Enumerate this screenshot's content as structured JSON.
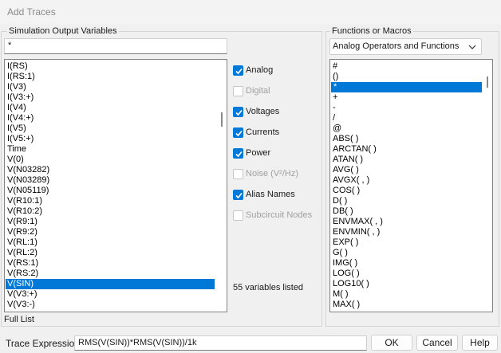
{
  "window": {
    "title": "Add Traces"
  },
  "left_panel": {
    "label": "Simulation Output Variables",
    "filter_value": "*",
    "variables": [
      "I(RS)",
      "I(RS:1)",
      "I(V3)",
      "I(V3:+)",
      "I(V4)",
      "I(V4:+)",
      "I(V5)",
      "I(V5:+)",
      "Time",
      "V(0)",
      "V(N03282)",
      "V(N03289)",
      "V(N05119)",
      "V(R10:1)",
      "V(R10:2)",
      "V(R9:1)",
      "V(R9:2)",
      "V(RL:1)",
      "V(RL:2)",
      "V(RS:1)",
      "V(RS:2)",
      "V(SIN)",
      "V(V3:+)",
      "V(V3:-)"
    ],
    "selected_index": 21,
    "footer": "Full List"
  },
  "options": {
    "items": [
      {
        "label": "Analog",
        "checked": true,
        "enabled": true
      },
      {
        "label": "Digital",
        "checked": false,
        "enabled": false
      },
      {
        "label": "Voltages",
        "checked": true,
        "enabled": true
      },
      {
        "label": "Currents",
        "checked": true,
        "enabled": true
      },
      {
        "label": "Power",
        "checked": true,
        "enabled": true
      },
      {
        "label": "Noise (V²/Hz)",
        "checked": false,
        "enabled": false
      },
      {
        "label": "Alias Names",
        "checked": true,
        "enabled": true
      },
      {
        "label": "Subcircuit Nodes",
        "checked": false,
        "enabled": false
      }
    ],
    "count_text": "55 variables listed"
  },
  "right_panel": {
    "label": "Functions or Macros",
    "dropdown_value": "Analog Operators and Functions",
    "functions": [
      "#",
      "()",
      "*",
      "+",
      "-",
      "/",
      "@",
      "ABS( )",
      "ARCTAN( )",
      "ATAN( )",
      "AVG( )",
      "AVGX( , )",
      "COS( )",
      "D( )",
      "DB( )",
      "ENVMAX( , )",
      "ENVMIN( , )",
      "EXP( )",
      "G( )",
      "IMG( )",
      "LOG( )",
      "LOG10( )",
      "M( )",
      "MAX( )"
    ],
    "selected_index": 2
  },
  "bottom": {
    "trace_label": "Trace Expression:",
    "trace_value": "RMS(V(SIN))*RMS(V(SIN))/1k",
    "ok_label": "OK",
    "cancel_label": "Cancel",
    "help_label": "Help"
  },
  "colors": {
    "accent": "#0078d7",
    "background": "#f0f0f0"
  }
}
